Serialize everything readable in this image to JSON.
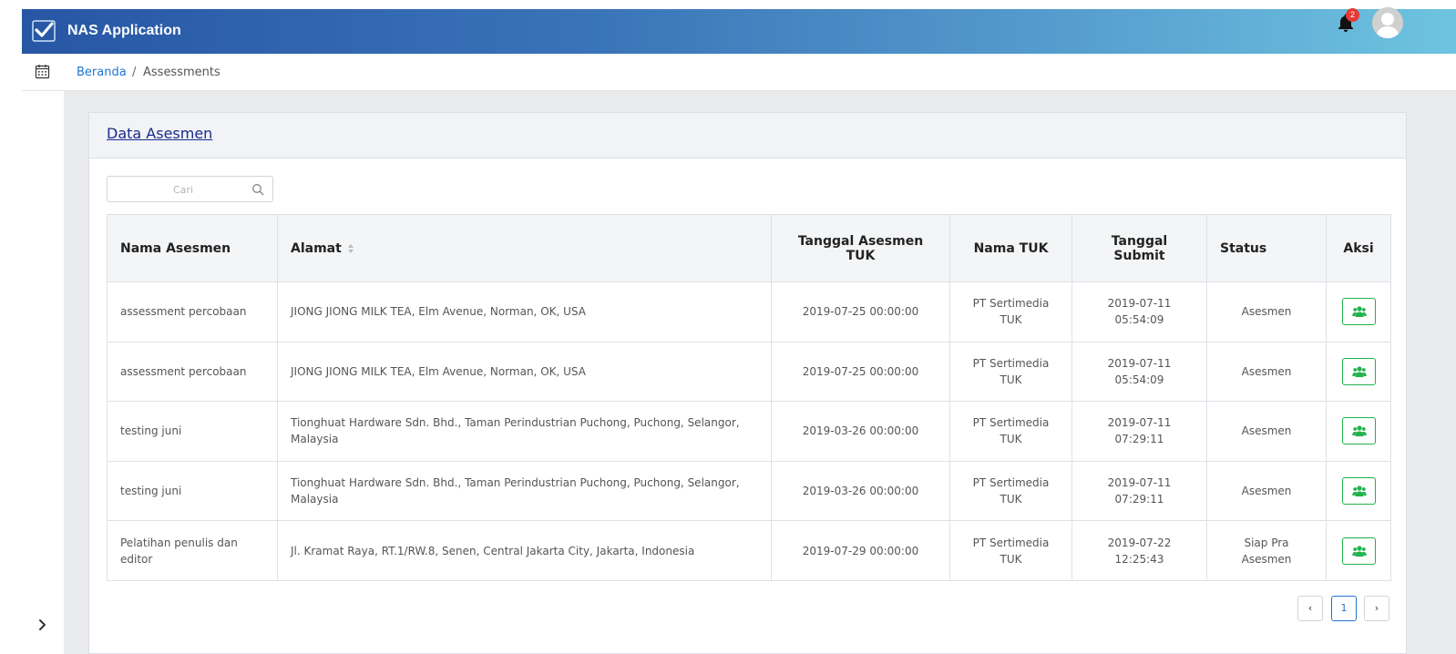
{
  "app": {
    "title": "NAS Application",
    "notification_count": "2"
  },
  "breadcrumb": {
    "home": "Beranda",
    "separator": "/",
    "current": "Assessments"
  },
  "card": {
    "title": "Data Asesmen"
  },
  "search": {
    "placeholder": "Cari"
  },
  "table": {
    "headers": {
      "nama_asesmen": "Nama Asesmen",
      "alamat": "Alamat",
      "tanggal_asesmen_tuk": "Tanggal Asesmen TUK",
      "nama_tuk": "Nama TUK",
      "tanggal_submit": "Tanggal Submit",
      "status": "Status",
      "aksi": "Aksi"
    },
    "rows": [
      {
        "nama": "assessment percobaan",
        "alamat": "JIONG JIONG MILK TEA, Elm Avenue, Norman, OK, USA",
        "tanggal": "2019-07-25 00:00:00",
        "tuk": "PT Sertimedia TUK",
        "submit": "2019-07-11 05:54:09",
        "status": "Asesmen"
      },
      {
        "nama": "assessment percobaan",
        "alamat": "JIONG JIONG MILK TEA, Elm Avenue, Norman, OK, USA",
        "tanggal": "2019-07-25 00:00:00",
        "tuk": "PT Sertimedia TUK",
        "submit": "2019-07-11 05:54:09",
        "status": "Asesmen"
      },
      {
        "nama": "testing juni",
        "alamat": "Tionghuat Hardware Sdn. Bhd., Taman Perindustrian Puchong, Puchong, Selangor, Malaysia",
        "tanggal": "2019-03-26 00:00:00",
        "tuk": "PT Sertimedia TUK",
        "submit": "2019-07-11 07:29:11",
        "status": "Asesmen"
      },
      {
        "nama": "testing juni",
        "alamat": "Tionghuat Hardware Sdn. Bhd., Taman Perindustrian Puchong, Puchong, Selangor, Malaysia",
        "tanggal": "2019-03-26 00:00:00",
        "tuk": "PT Sertimedia TUK",
        "submit": "2019-07-11 07:29:11",
        "status": "Asesmen"
      },
      {
        "nama": "Pelatihan penulis dan editor",
        "alamat": "Jl. Kramat Raya, RT.1/RW.8, Senen, Central Jakarta City, Jakarta, Indonesia",
        "tanggal": "2019-07-29 00:00:00",
        "tuk": "PT Sertimedia TUK",
        "submit": "2019-07-22 12:25:43",
        "status": "Siap Pra Asesmen"
      }
    ]
  },
  "pagination": {
    "prev": "‹",
    "current_page": "1",
    "next": "›"
  },
  "colors": {
    "header_start": "#2756a5",
    "header_end": "#6ec4e0",
    "link": "#1f74d4",
    "action_green": "#22b14c",
    "badge_red": "#e53935"
  },
  "icons": {
    "logo": "checkmark-logo-icon",
    "bell": "bell-icon",
    "avatar": "user-avatar-icon",
    "calendar": "calendar-icon",
    "search": "search-icon",
    "sort": "sort-icon",
    "action": "users-group-icon",
    "sidebar_toggle": "chevron-right-icon"
  }
}
